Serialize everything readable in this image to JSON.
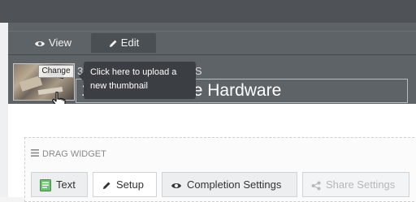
{
  "tabs": [
    {
      "label": "View",
      "icon": "eye-icon"
    },
    {
      "label": "Edit",
      "icon": "pencil-icon"
    }
  ],
  "thumbnail": {
    "change_label": "Change",
    "tooltip_line1": "Click here to upload a",
    "tooltip_line2": "new thumbnail"
  },
  "header": {
    "category": "3 — E DIGITAL DEVICES",
    "title": "1 Mobile Device Hardware"
  },
  "widget": {
    "drag_label": "DRAG WIDGET",
    "buttons": {
      "text": "Text",
      "setup": "Setup",
      "completion": "Completion Settings",
      "share": "Share Settings"
    }
  },
  "colors": {
    "header_bg": "#5e6368",
    "tooltip_bg": "#3b3f43",
    "topbar_bg": "#4f5358"
  }
}
